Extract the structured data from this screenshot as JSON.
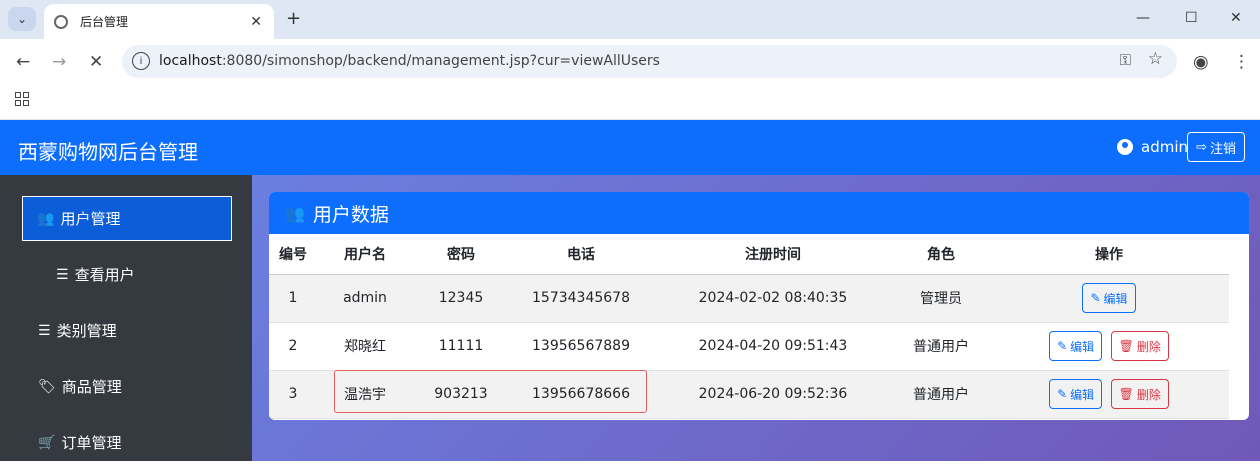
{
  "browser": {
    "tab_title": "后台管理",
    "url_host": "localhost",
    "url_rest": ":8080/simonshop/backend/management.jsp?cur=viewAllUsers"
  },
  "header": {
    "brand": "西蒙购物网后台管理",
    "username": "admin",
    "logout_label": "注销"
  },
  "sidebar": {
    "items": [
      {
        "label": "用户管理",
        "icon": "users-icon"
      },
      {
        "label": "查看用户",
        "icon": "list-icon"
      },
      {
        "label": "类别管理",
        "icon": "list-icon"
      },
      {
        "label": "商品管理",
        "icon": "tags-icon"
      },
      {
        "label": "订单管理",
        "icon": "cart-icon"
      }
    ]
  },
  "card": {
    "title": "用户数据",
    "columns": [
      "编号",
      "用户名",
      "密码",
      "电话",
      "注册时间",
      "角色",
      "操作"
    ],
    "edit_label": "编辑",
    "delete_label": "删除",
    "rows": [
      {
        "id": "1",
        "name": "admin",
        "password": "12345",
        "phone": "15734345678",
        "time": "2024-02-02 08:40:35",
        "role": "管理员"
      },
      {
        "id": "2",
        "name": "郑晓红",
        "password": "11111",
        "phone": "13956567889",
        "time": "2024-04-20 09:51:43",
        "role": "普通用户"
      },
      {
        "id": "3",
        "name": "温浩宇",
        "password": "903213",
        "phone": "13956678666",
        "time": "2024-06-20 09:52:36",
        "role": "普通用户"
      }
    ]
  },
  "colors": {
    "primary": "#0d6efd",
    "danger": "#dc3545",
    "sidebar": "#343a40"
  }
}
